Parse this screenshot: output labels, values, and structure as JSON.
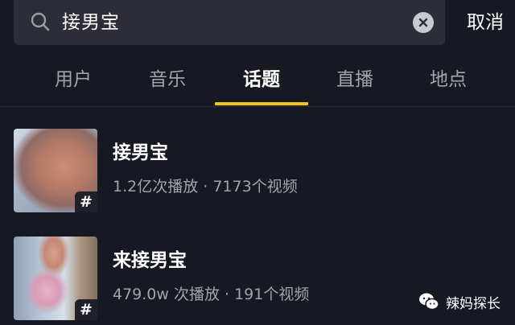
{
  "search": {
    "query": "接男宝",
    "cancel_label": "取消"
  },
  "tabs": [
    {
      "label": "用户",
      "active": false
    },
    {
      "label": "音乐",
      "active": false
    },
    {
      "label": "话题",
      "active": true
    },
    {
      "label": "直播",
      "active": false
    },
    {
      "label": "地点",
      "active": false
    }
  ],
  "results": [
    {
      "title": "接男宝",
      "meta": "1.2亿次播放 · 7173个视频",
      "badge": "#"
    },
    {
      "title": "来接男宝",
      "meta": "479.0w 次播放 · 191个视频",
      "badge": "#"
    }
  ],
  "watermark": {
    "label": "辣妈探长"
  },
  "colors": {
    "background": "#161822",
    "search_box": "#2c2d36",
    "accent_indicator": "#f5c518",
    "inactive_tab": "#a3a4a9"
  }
}
